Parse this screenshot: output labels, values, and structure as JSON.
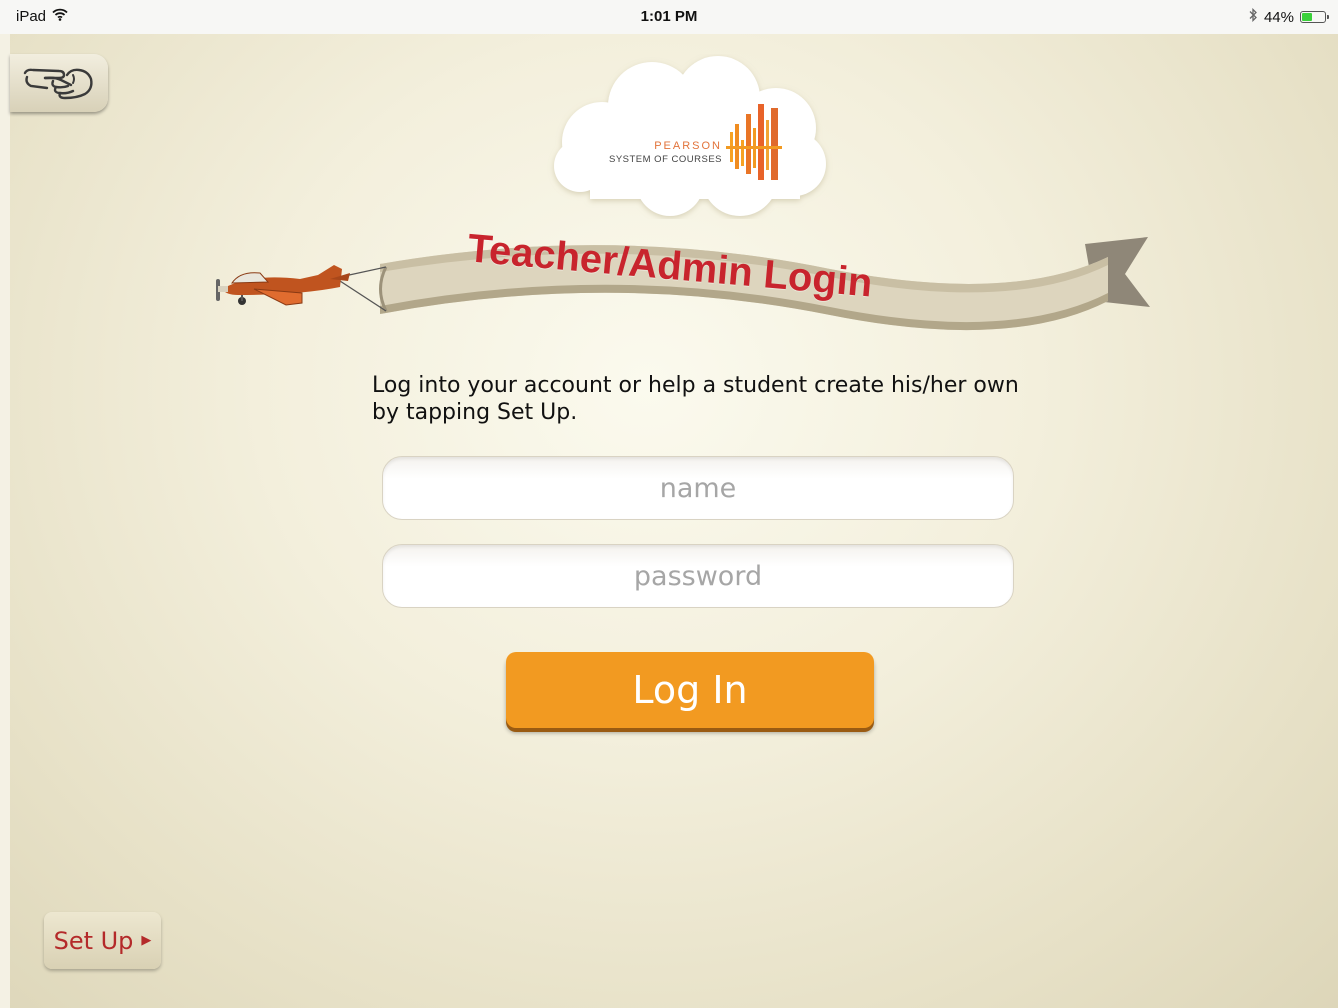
{
  "status_bar": {
    "device": "iPad",
    "time": "1:01 PM",
    "battery_percent": "44%",
    "battery_level": 0.44,
    "icons": [
      "wifi-icon",
      "bluetooth-icon",
      "battery-icon"
    ]
  },
  "logo": {
    "brand": "PEARSON",
    "product": "SYSTEM OF COURSES"
  },
  "banner": {
    "title": "Teacher/Admin Login"
  },
  "instructions": "Log into your account or help a student create his/her own by tapping Set Up.",
  "form": {
    "name_placeholder": "name",
    "name_value": "",
    "password_placeholder": "password",
    "password_value": "",
    "login_label": "Log In"
  },
  "setup": {
    "label": "Set Up"
  },
  "colors": {
    "accent_orange": "#f29a21",
    "title_red": "#c8242d",
    "setup_red": "#b42a2a",
    "background": "#f4f1e4"
  }
}
